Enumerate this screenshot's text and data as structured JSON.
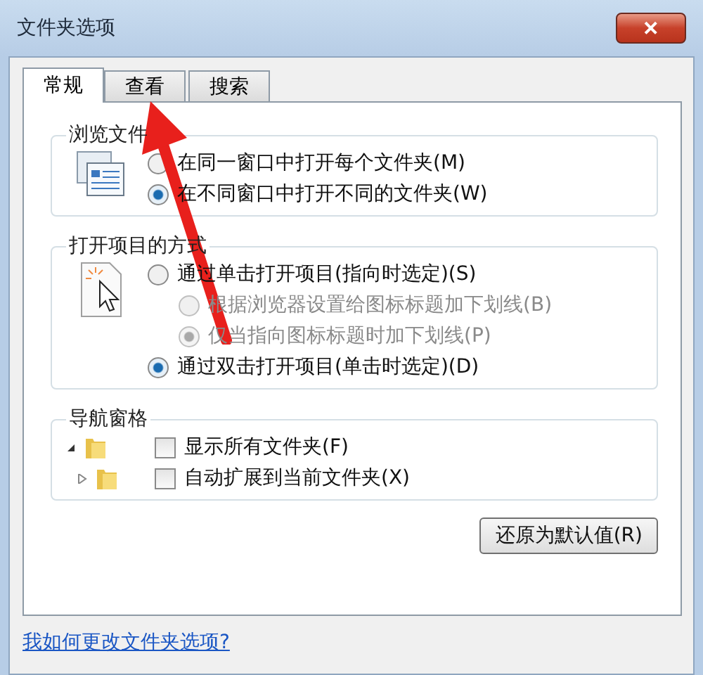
{
  "window": {
    "title": "文件夹选项",
    "close": "✕"
  },
  "tabs": [
    {
      "label": "常规",
      "selected": true
    },
    {
      "label": "查看",
      "selected": false
    },
    {
      "label": "搜索",
      "selected": false
    }
  ],
  "groups": [
    {
      "title": "浏览文件",
      "kind": "radio",
      "options": [
        {
          "label": "在同一窗口中打开每个文件夹(M)",
          "selected": false,
          "disabled": false
        },
        {
          "label": "在不同窗口中打开不同的文件夹(W)",
          "selected": true,
          "disabled": false
        }
      ]
    },
    {
      "title": "打开项目的方式",
      "kind": "radio",
      "options": [
        {
          "label": "通过单击打开项目(指向时选定)(S)",
          "selected": false,
          "disabled": false,
          "children": [
            {
              "label": "根据浏览器设置给图标标题加下划线(B)",
              "selected": false,
              "disabled": true
            },
            {
              "label": "仅当指向图标标题时加下划线(P)",
              "selected": true,
              "disabled": true
            }
          ]
        },
        {
          "label": "通过双击打开项目(单击时选定)(D)",
          "selected": true,
          "disabled": false
        }
      ]
    },
    {
      "title": "导航窗格",
      "kind": "checkbox",
      "options": [
        {
          "label": "显示所有文件夹(F)",
          "checked": false
        },
        {
          "label": "自动扩展到当前文件夹(X)",
          "checked": false
        }
      ]
    }
  ],
  "restore_button": "还原为默认值(R)",
  "help_link": "我如何更改文件夹选项?"
}
